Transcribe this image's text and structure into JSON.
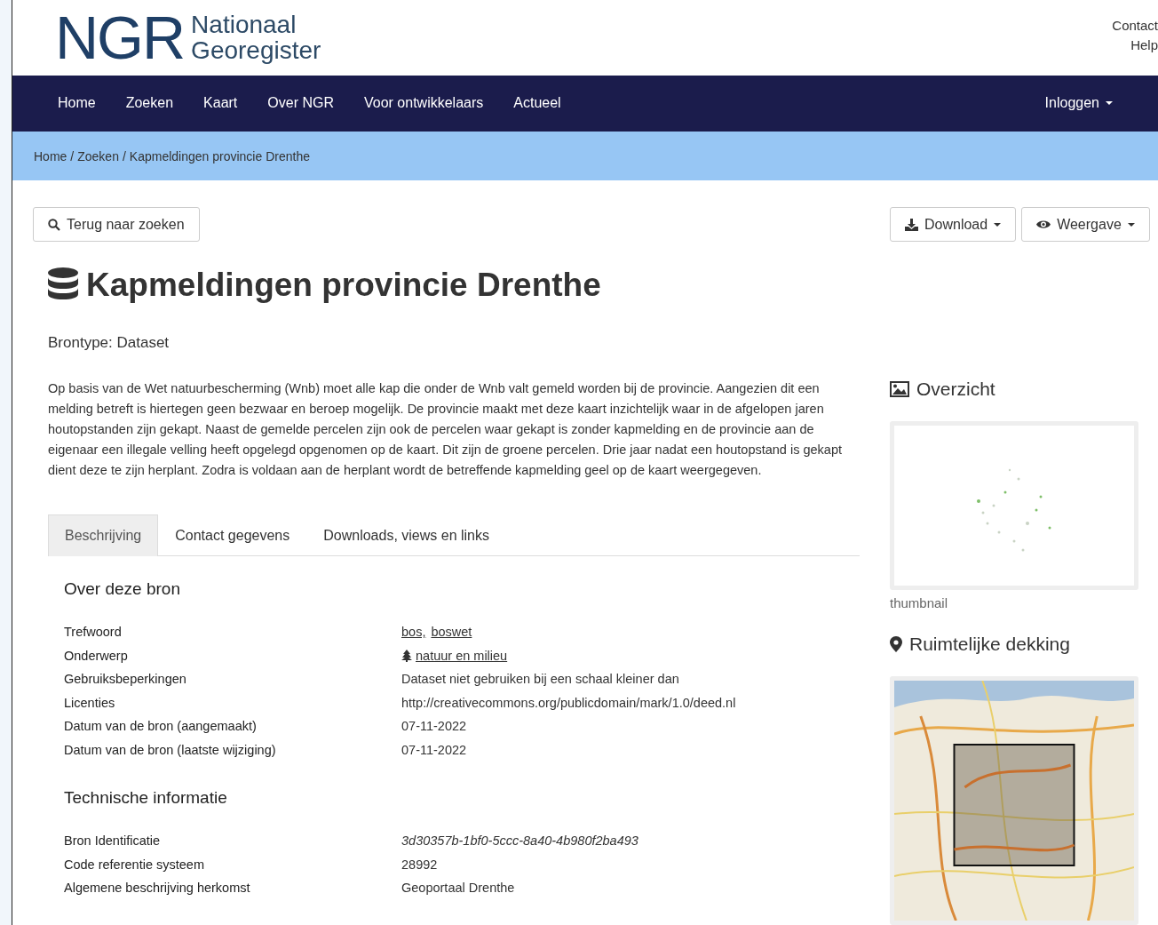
{
  "header": {
    "logo": {
      "initials": "NGR",
      "line1": "Nationaal",
      "line2": "Georegister"
    },
    "top_links": [
      "Contact",
      "Help"
    ]
  },
  "nav": {
    "items": [
      {
        "label": "Home"
      },
      {
        "label": "Zoeken"
      },
      {
        "label": "Kaart"
      },
      {
        "label": "Over NGR"
      },
      {
        "label": "Voor ontwikkelaars"
      },
      {
        "label": "Actueel"
      }
    ],
    "login": {
      "label": "Inloggen"
    }
  },
  "breadcrumb": {
    "separator": "/",
    "items": [
      "Home",
      "Zoeken",
      "Kapmeldingen provincie Drenthe"
    ]
  },
  "toolbar": {
    "back_button": "Terug naar zoeken",
    "download_button": "Download",
    "view_button": "Weergave"
  },
  "title": "Kapmeldingen provincie Drenthe",
  "source_type": "Brontype: Dataset",
  "description": "Op basis van de Wet natuurbescherming (Wnb) moet alle kap die onder de Wnb valt gemeld worden bij de provincie. Aangezien dit een melding betreft is hiertegen geen bezwaar en beroep mogelijk. De provincie maakt met deze kaart inzichtelijk waar in de afgelopen jaren houtopstanden zijn gekapt. Naast de gemelde percelen zijn ook de percelen waar gekapt is zonder kapmelding en de provincie aan de eigenaar een illegale velling heeft opgelegd opgenomen op de kaart. Dit zijn de groene percelen. Drie jaar nadat een houtopstand is gekapt dient deze te zijn herplant. Zodra is voldaan aan de herplant wordt de betreffende kapmelding geel op de kaart weergegeven.",
  "tabs": [
    {
      "label": "Beschrijving",
      "selected": true
    },
    {
      "label": "Contact gegevens",
      "selected": false
    },
    {
      "label": "Downloads, views en links",
      "selected": false
    }
  ],
  "sections": [
    {
      "heading": "Over deze bron",
      "rows": [
        {
          "label": "Trefwoord",
          "kind": "links",
          "values": [
            "bos,",
            "boswet"
          ]
        },
        {
          "label": "Onderwerp",
          "kind": "topic",
          "values": [
            "natuur en milieu"
          ]
        },
        {
          "label": "Gebruiksbeperkingen",
          "kind": "text",
          "values": [
            "Dataset niet gebruiken bij een schaal kleiner dan"
          ]
        },
        {
          "label": "Licenties",
          "kind": "text",
          "values": [
            "http://creativecommons.org/publicdomain/mark/1.0/deed.nl"
          ]
        },
        {
          "label": "Datum van de bron (aangemaakt)",
          "kind": "text",
          "values": [
            "07-11-2022"
          ]
        },
        {
          "label": "Datum van de bron (laatste wijziging)",
          "kind": "text",
          "values": [
            "07-11-2022"
          ]
        }
      ]
    },
    {
      "heading": "Technische informatie",
      "rows": [
        {
          "label": "Bron Identificatie",
          "kind": "italic",
          "values": [
            "3d30357b-1bf0-5ccc-8a40-4b980f2ba493"
          ]
        },
        {
          "label": "Code referentie systeem",
          "kind": "text",
          "values": [
            "28992"
          ]
        },
        {
          "label": "Algemene beschrijving herkomst",
          "kind": "text",
          "values": [
            "Geoportaal Drenthe"
          ]
        }
      ]
    }
  ],
  "sidebar": {
    "overview": {
      "heading": "Overzicht",
      "caption": "thumbnail"
    },
    "coverage": {
      "heading": "Ruimtelijke dekking"
    }
  }
}
